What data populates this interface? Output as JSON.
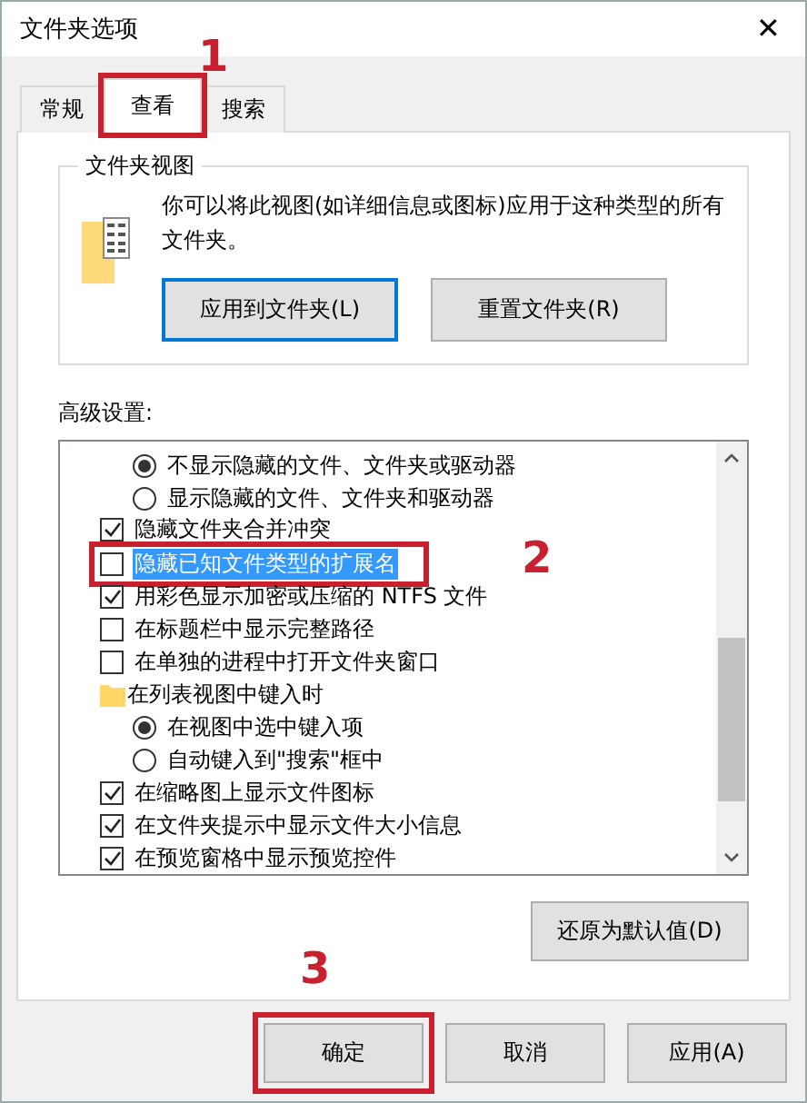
{
  "window": {
    "title": "文件夹选项",
    "close": "✕"
  },
  "tabs": [
    {
      "label": "常规",
      "selected": false
    },
    {
      "label": "查看",
      "selected": true,
      "callout": "1"
    },
    {
      "label": "搜索",
      "selected": false
    }
  ],
  "folder_views": {
    "title": "文件夹视图",
    "description": "你可以将此视图(如详细信息或图标)应用于这种类型的所有文件夹。",
    "buttons": [
      {
        "label": "应用到文件夹(L)",
        "default": true
      },
      {
        "label": "重置文件夹(R)",
        "default": false
      }
    ]
  },
  "advanced": {
    "title": "高级设置:",
    "items": [
      {
        "kind": "group",
        "children": [
          {
            "kind": "radio",
            "label": "不显示隐藏的文件、文件夹或驱动器",
            "checked": true,
            "selected": false
          },
          {
            "kind": "radio",
            "label": "显示隐藏的文件、文件夹和驱动器",
            "checked": false,
            "selected": false
          }
        ]
      },
      {
        "kind": "checkbox",
        "label": "隐藏文件夹合并冲突",
        "checked": true,
        "selected": false
      },
      {
        "kind": "checkbox",
        "label": "隐藏已知文件类型的扩展名",
        "checked": false,
        "selected": true,
        "callout": "2"
      },
      {
        "kind": "checkbox",
        "label": "用彩色显示加密或压缩的 NTFS 文件",
        "checked": true,
        "selected": false
      },
      {
        "kind": "checkbox",
        "label": "在标题栏中显示完整路径",
        "checked": false,
        "selected": false
      },
      {
        "kind": "checkbox",
        "label": "在单独的进程中打开文件夹窗口",
        "checked": false,
        "selected": false
      },
      {
        "kind": "folder",
        "label": "在列表视图中键入时",
        "children": [
          {
            "kind": "radio",
            "label": "在视图中选中键入项",
            "checked": true,
            "selected": false
          },
          {
            "kind": "radio",
            "label": "自动键入到\"搜索\"框中",
            "checked": false,
            "selected": false
          }
        ]
      },
      {
        "kind": "checkbox",
        "label": "在缩略图上显示文件图标",
        "checked": true,
        "selected": false
      },
      {
        "kind": "checkbox",
        "label": "在文件夹提示中显示文件大小信息",
        "checked": true,
        "selected": false
      },
      {
        "kind": "checkbox",
        "label": "在预览窗格中显示预览控件",
        "checked": true,
        "selected": false
      }
    ],
    "restore_button": "还原为默认值(D)"
  },
  "footer_buttons": [
    {
      "label": "确定",
      "callout": "3"
    },
    {
      "label": "取消"
    },
    {
      "label": "应用(A)"
    }
  ]
}
